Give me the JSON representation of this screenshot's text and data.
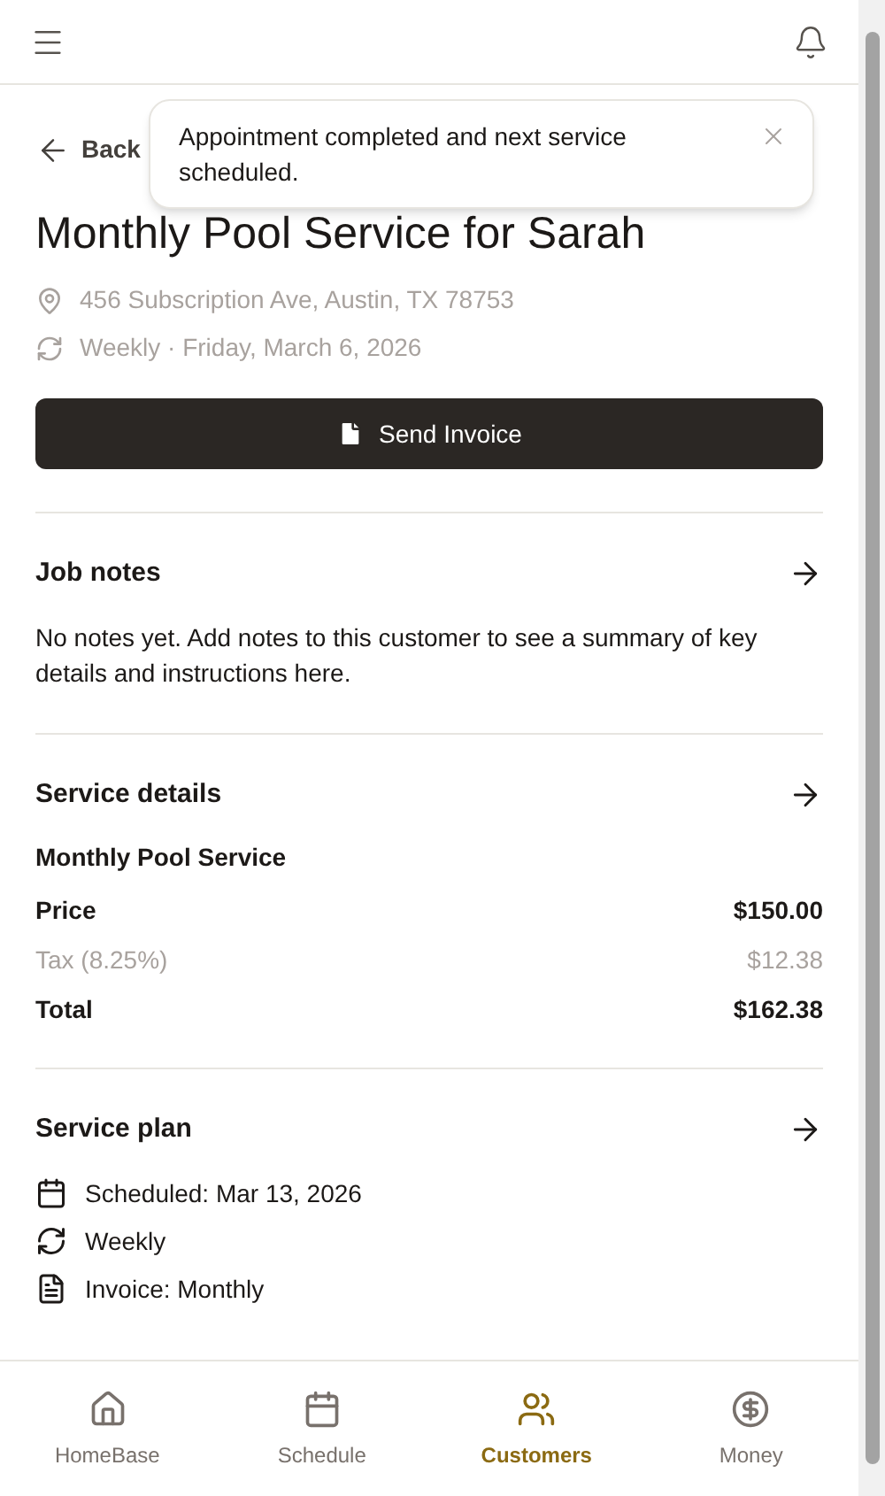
{
  "header": {
    "menu": true,
    "notifications": true
  },
  "back": {
    "label": "Back"
  },
  "title": "Monthly Pool Service for Sarah",
  "toast": {
    "message": "Appointment completed and next service scheduled."
  },
  "meta": [
    {
      "kind": "location",
      "text": "456 Subscription Ave, Austin, TX 78753"
    },
    {
      "kind": "repeat",
      "text": "Weekly · Friday, March 6, 2026"
    }
  ],
  "primary_button": {
    "label": "Send Invoice"
  },
  "job_notes": {
    "title": "Job notes",
    "text": "No notes yet. Add notes to this customer to see a summary of key details and instructions here."
  },
  "service_details": {
    "title": "Service details",
    "service": "Monthly Pool Service",
    "lines": [
      {
        "kind": "strong",
        "label": "Price",
        "value": "$150.00"
      },
      {
        "kind": "muted",
        "label": "Tax (8.25%)",
        "value": "$12.38"
      },
      {
        "kind": "strong",
        "label": "Total",
        "value": "$162.38"
      }
    ]
  },
  "service_plan": {
    "title": "Service plan",
    "items": [
      {
        "kind": "calendar",
        "text": "Scheduled: Mar 13, 2026"
      },
      {
        "kind": "repeat",
        "text": "Weekly"
      },
      {
        "kind": "document",
        "text": "Invoice: Monthly"
      }
    ]
  },
  "nav": [
    {
      "kind": "home",
      "label": "HomeBase",
      "selected": false
    },
    {
      "kind": "calendar",
      "label": "Schedule",
      "selected": false
    },
    {
      "kind": "people",
      "label": "Customers",
      "selected": true
    },
    {
      "kind": "money",
      "label": "Money",
      "selected": false
    }
  ]
}
